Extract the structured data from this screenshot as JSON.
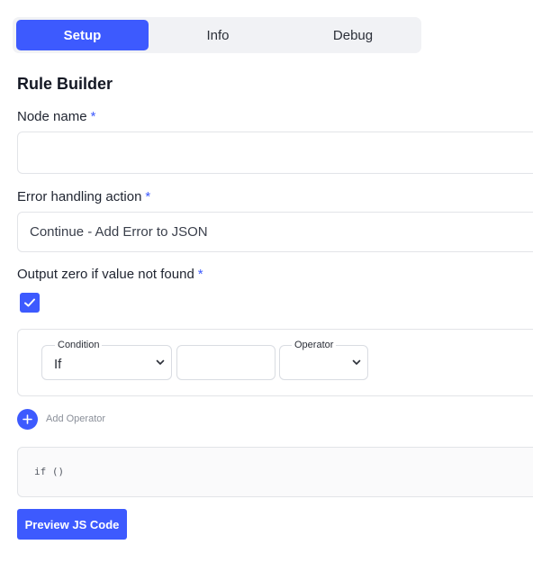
{
  "tabs": [
    {
      "label": "Setup",
      "active": true
    },
    {
      "label": "Info",
      "active": false
    },
    {
      "label": "Debug",
      "active": false
    }
  ],
  "title": "Rule Builder",
  "required_mark": "*",
  "node_name": {
    "label": "Node name",
    "value": ""
  },
  "error_handling": {
    "label": "Error handling action",
    "value": "Continue - Add Error to JSON"
  },
  "output_zero": {
    "label": "Output zero if value not found",
    "checked": true
  },
  "condition_row": {
    "condition": {
      "legend": "Condition",
      "value": "If"
    },
    "value_input": "",
    "operator": {
      "legend": "Operator",
      "value": ""
    }
  },
  "add_operator": {
    "label": "Add Operator",
    "icon": "plus-icon"
  },
  "code_preview": "if ()",
  "preview_button": "Preview JS Code",
  "colors": {
    "accent": "#3d5afe",
    "border": "#e2e4e8"
  }
}
